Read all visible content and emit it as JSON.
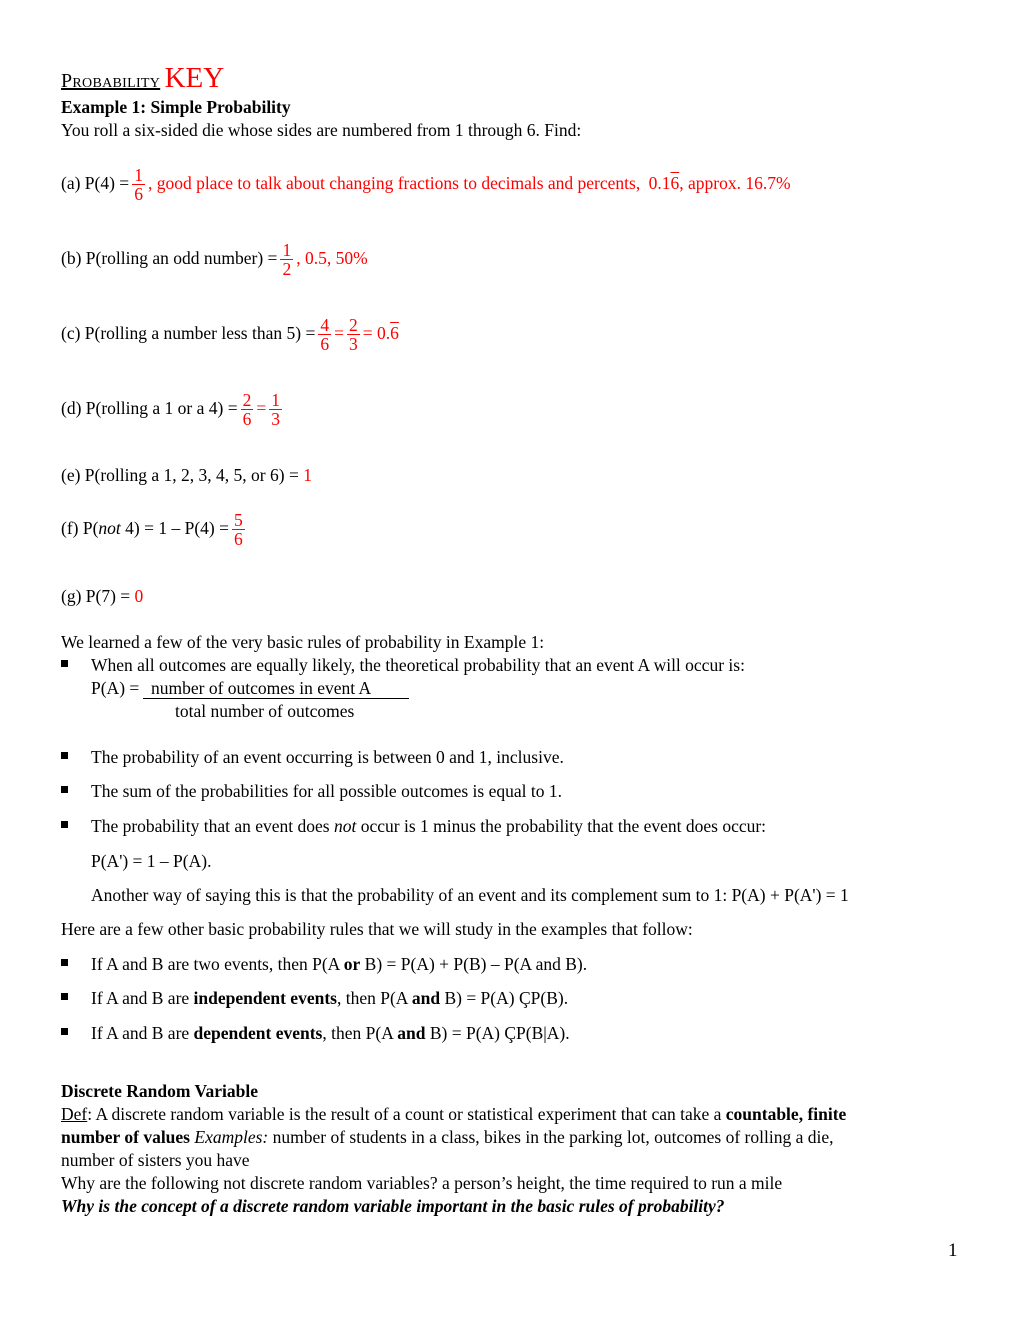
{
  "header": {
    "title_prefix": "Probability",
    "title_key": "KEY"
  },
  "example1": {
    "heading": "Example 1: Simple Probability",
    "intro": "You roll a six-sided die whose sides are numbered from 1 through 6. Find:",
    "a": {
      "label": "(a) P(4) =",
      "frac_num": "1",
      "frac_den": "6",
      "comment": ", good place to talk about changing fractions to decimals and percents,",
      "decimal_prefix": "0.1",
      "decimal_repeat": "6",
      "suffix": ", approx. 16.7%"
    },
    "b": {
      "label": "(b) P(rolling an odd number) =",
      "frac_num": "1",
      "frac_den": "2",
      "suffix": ", 0.5, 50%"
    },
    "c": {
      "label": "(c) P(rolling a number less than 5) =",
      "frac1_num": "4",
      "frac1_den": "6",
      "frac2_num": "2",
      "frac2_den": "3",
      "eq": "=",
      "decimal_prefix": "0.",
      "decimal_repeat": "6"
    },
    "d": {
      "label": "(d) P(rolling a 1 or a 4) =",
      "frac1_num": "2",
      "frac1_den": "6",
      "frac2_num": "1",
      "frac2_den": "3",
      "eq": "="
    },
    "e": {
      "label": "(e) P(rolling a 1, 2, 3, 4, 5, or 6) =",
      "answer": "1"
    },
    "f": {
      "label_pre": "(f) P(",
      "label_ital": "not",
      "label_post": " 4) = 1 – P(4) =",
      "frac_num": "5",
      "frac_den": "6"
    },
    "g": {
      "label": "(g) P(7) =",
      "answer": "0"
    }
  },
  "rules": {
    "intro": "We learned a few of the very basic rules of probability in Example 1:",
    "bullet1": "When all outcomes are equally likely, the theoretical probability that an event A will occur is:",
    "formula_lhs": "P(A) =",
    "formula_num": "number of outcomes in event A",
    "formula_den": "total number of outcomes",
    "bullet2": "The probability of an event occurring is between 0 and 1, inclusive.",
    "bullet3": "The sum of the probabilities for all possible outcomes is equal to 1.",
    "bullet4_pre": "The probability that an event does ",
    "bullet4_ital": "not",
    "bullet4_post": " occur is 1 minus the probability that the event does occur:",
    "bullet4_formula": "P(A') = 1 – P(A).",
    "bullet4_extra": "Another way of saying this is that the probability of an event and its complement sum to 1: P(A) + P(A') = 1",
    "other_intro": "Here are a few other basic probability rules that we will study in the examples that follow:",
    "bullet5_pre": "If A and B are two events, then P(A ",
    "bullet5_bold": "or",
    "bullet5_post": " B) = P(A) + P(B) – P(A and B).",
    "bullet6_pre": "If A and B are ",
    "bullet6_bold": "independent events",
    "bullet6_mid": ", then P(A ",
    "bullet6_bold2": "and",
    "bullet6_post": " B) = P(A) ÇP(B).",
    "bullet7_pre": "If A and B are ",
    "bullet7_bold": "dependent events",
    "bullet7_mid": ", then P(A ",
    "bullet7_bold2": "and",
    "bullet7_post": " B) = P(A) ÇP(B|A)."
  },
  "discrete": {
    "heading": "Discrete Random Variable",
    "def_label": "Def",
    "def_text": ": A discrete random variable is the result of a count or statistical experiment that can take a ",
    "def_bold1": "countable, finite",
    "def_bold2": "number of values",
    "examples_label": " Examples:",
    "examples_text": " number of students in a class, bikes in the parking lot, outcomes of rolling a die,",
    "examples_text2": "number of sisters you have",
    "why_not": "Why are the following not discrete random variables? a person’s height, the time required to run a mile",
    "why_important": "Why is the concept of a discrete random variable important in the basic rules of probability?"
  },
  "footer": {
    "page_number": "1"
  }
}
